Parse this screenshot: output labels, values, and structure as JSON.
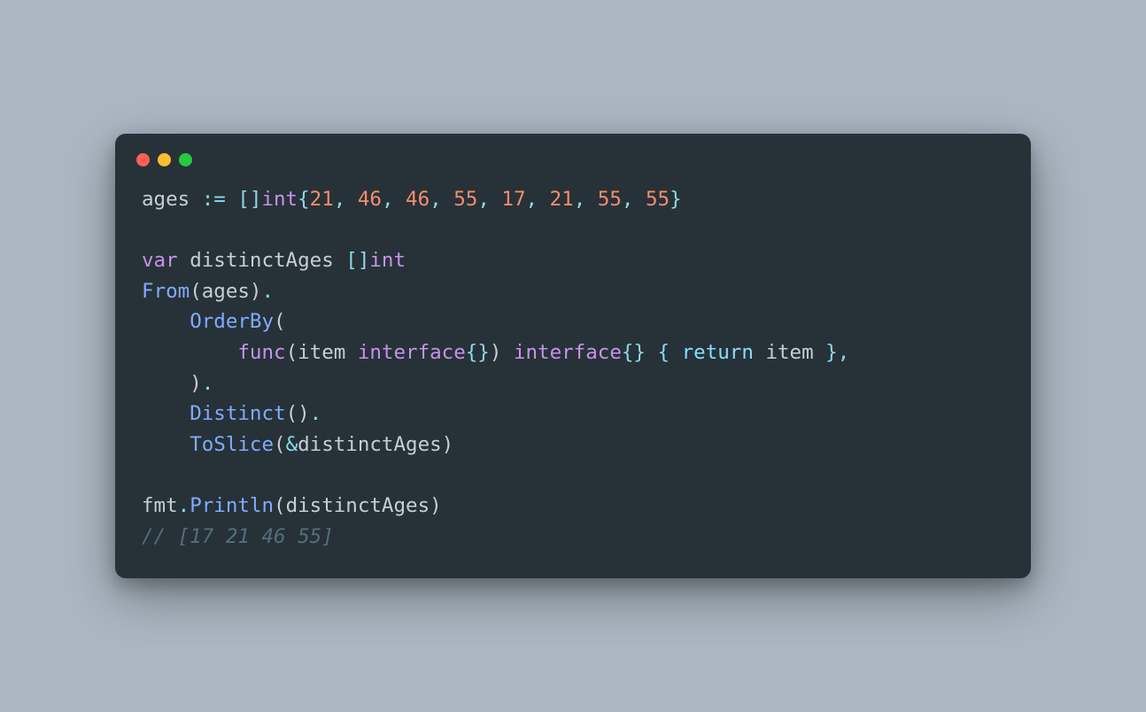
{
  "window": {
    "traffic_lights": [
      "red",
      "yellow",
      "green"
    ]
  },
  "code": {
    "line1": {
      "ident": "ages",
      "op": ":=",
      "bracket_open": "[]",
      "type": "int",
      "brace_open": "{",
      "n1": "21",
      "c1": ", ",
      "n2": "46",
      "c2": ", ",
      "n3": "46",
      "c3": ", ",
      "n4": "55",
      "c4": ", ",
      "n5": "17",
      "c5": ", ",
      "n6": "21",
      "c6": ", ",
      "n7": "55",
      "c7": ", ",
      "n8": "55",
      "brace_close": "}"
    },
    "line3": {
      "kw": "var",
      "ident": "distinctAges",
      "bracket": "[]",
      "type": "int"
    },
    "line4": {
      "func": "From",
      "popen": "(",
      "arg": "ages",
      "pclose": ")",
      "dot": "."
    },
    "line5": {
      "indent": "    ",
      "method": "OrderBy",
      "popen": "("
    },
    "line6": {
      "indent": "        ",
      "kw": "func",
      "popen": "(",
      "param": "item",
      "ptype_kw": "interface",
      "ptype_braces": "{}",
      "pclose": ")",
      "rtype_kw": "interface",
      "rtype_braces": "{}",
      "bopen": "{",
      "ret": "return",
      "retval": "item",
      "bclose": "}",
      "comma": ","
    },
    "line7": {
      "indent": "    ",
      "pclose": ")",
      "dot": "."
    },
    "line8": {
      "indent": "    ",
      "method": "Distinct",
      "popen": "(",
      "pclose": ")",
      "dot": "."
    },
    "line9": {
      "indent": "    ",
      "method": "ToSlice",
      "popen": "(",
      "amp": "&",
      "arg": "distinctAges",
      "pclose": ")"
    },
    "line11": {
      "pkg": "fmt",
      "dot": ".",
      "method": "Println",
      "popen": "(",
      "arg": "distinctAges",
      "pclose": ")"
    },
    "line12": {
      "comment": "// [17 21 46 55]"
    }
  }
}
